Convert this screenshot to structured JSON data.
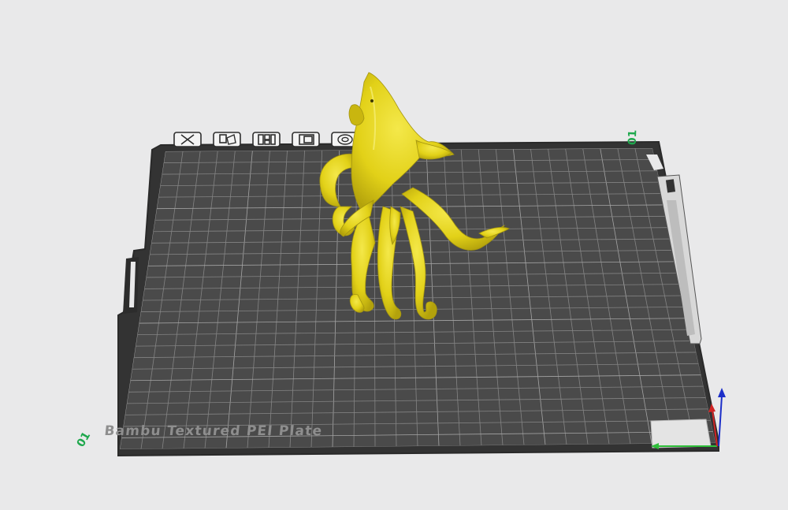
{
  "viewport": {
    "background_color": "#e9e9ea"
  },
  "plate": {
    "name_label": "Bambu Textured PEI Plate",
    "surface_color": "#4a4a4a",
    "grid_color": "#9a9a9a",
    "frame_color": "#3a3a3a"
  },
  "plate_toolbar": {
    "buttons": [
      {
        "name": "remove-plate-button",
        "icon": "x-icon"
      },
      {
        "name": "auto-arrange-button",
        "icon": "arrange-icon"
      },
      {
        "name": "orient-plate-button",
        "icon": "grid-layout-icon"
      },
      {
        "name": "lock-plate-button",
        "icon": "plate-lock-icon"
      },
      {
        "name": "plate-settings-button",
        "icon": "gear-icon"
      }
    ]
  },
  "plate_index": {
    "back_right": "01",
    "front_left": "01"
  },
  "model": {
    "name": "shark-octopus",
    "color": "#e6d51a"
  },
  "axes": {
    "x_color": "#2fbf3a",
    "y_color": "#d12424",
    "z_color": "#1c2fc9"
  }
}
